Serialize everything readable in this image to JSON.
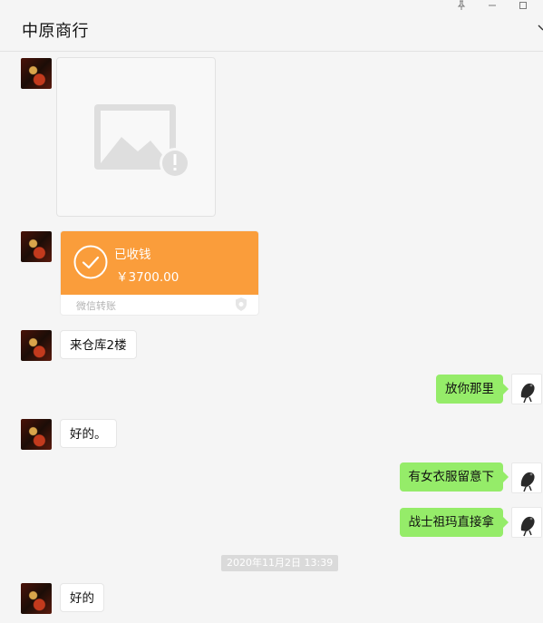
{
  "window": {
    "title": "中原商行",
    "pin_icon": "pin-icon",
    "minimize_icon": "minimize-icon",
    "maximize_icon": "maximize-icon"
  },
  "colors": {
    "background": "#f5f5f5",
    "outgoing_bubble": "#95ec69",
    "incoming_bubble": "#ffffff",
    "transfer_card": "#fa9d3b",
    "timestamp_bg": "#dadada"
  },
  "messages": {
    "image": {
      "icon": "broken-image-icon"
    },
    "transfer": {
      "status": "已收钱",
      "amount": "￥3700.00",
      "label": "微信转账",
      "icon": "check-circle-icon",
      "shield_icon": "shield-icon"
    },
    "m1": {
      "text": "来仓库2楼"
    },
    "m2": {
      "text": "放你那里"
    },
    "m3": {
      "text": "好的。"
    },
    "m4": {
      "text": "有女衣服留意下"
    },
    "m5": {
      "text": "战士祖玛直接拿"
    },
    "timestamp": "2020年11月2日 13:39",
    "m6": {
      "text": "好的"
    }
  }
}
